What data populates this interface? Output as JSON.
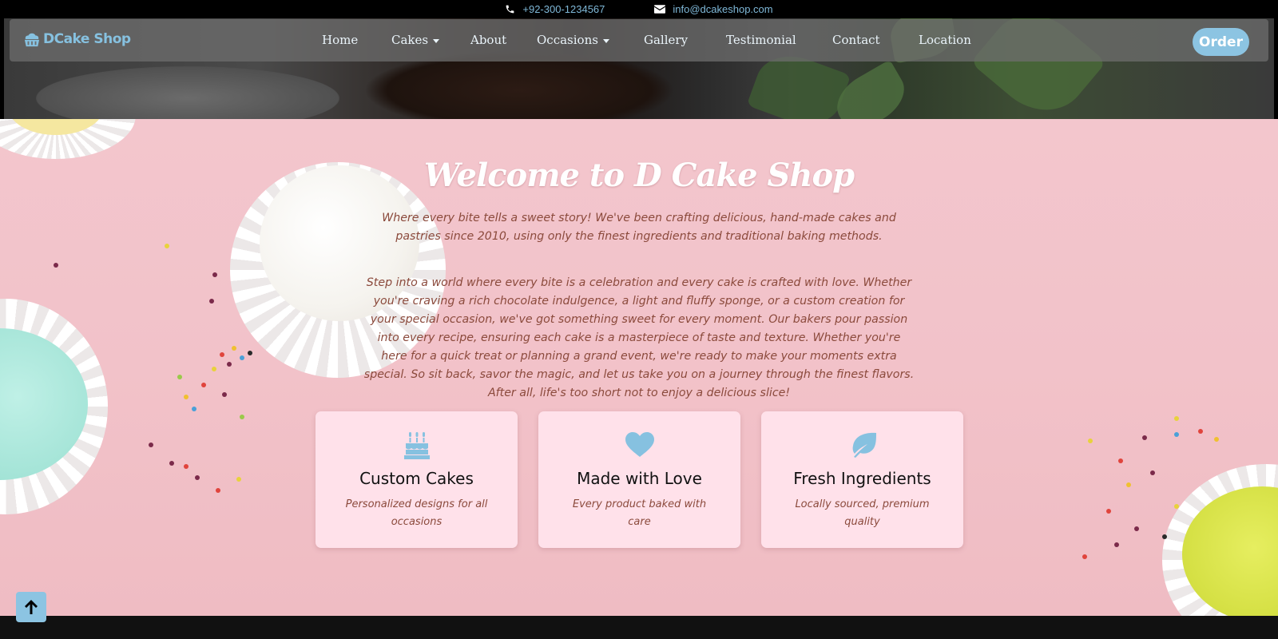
{
  "topbar": {
    "phone": "+92-300-1234567",
    "email": "info@dcakeshop.com",
    "phone_icon": "phone-icon",
    "email_icon": "envelope-icon"
  },
  "navbar": {
    "brand": "DCake Shop",
    "brand_icon": "cake-icon",
    "links": [
      {
        "label": "Home",
        "dropdown": false
      },
      {
        "label": "Cakes",
        "dropdown": true
      },
      {
        "label": "About",
        "dropdown": false
      },
      {
        "label": "Occasions",
        "dropdown": true
      },
      {
        "label": "Gallery",
        "dropdown": false
      },
      {
        "label": "Testimonial",
        "dropdown": false
      },
      {
        "label": "Contact",
        "dropdown": false
      },
      {
        "label": "Location",
        "dropdown": false
      }
    ],
    "order_label": "Order"
  },
  "welcome": {
    "title": "Welcome to D Cake Shop",
    "intro": "Where every bite tells a sweet story! We've been crafting delicious, hand-made cakes and pastries since 2010, using only the finest ingredients and traditional baking methods.",
    "story": "Step into a world where every bite is a celebration and every cake is crafted with love. Whether you're craving a rich chocolate indulgence, a light and fluffy sponge, or a custom creation for your special occasion, we've got something sweet for every moment. Our bakers pour passion into every recipe, ensuring each cake is a masterpiece of taste and texture. Whether you're here for a quick treat or planning a grand event, we're ready to make your moments extra special. So sit back, savor the magic, and let us take you on a journey through the finest flavors. After all, life's too short not to enjoy a delicious slice!"
  },
  "features": [
    {
      "icon": "birthday-cake-icon",
      "title": "Custom Cakes",
      "desc": "Personalized designs for all occasions"
    },
    {
      "icon": "heart-icon",
      "title": "Made with Love",
      "desc": "Every product baked with care"
    },
    {
      "icon": "leaf-icon",
      "title": "Fresh Ingredients",
      "desc": "Locally sourced, premium quality"
    }
  ],
  "back_to_top_icon": "arrow-up-icon",
  "colors": {
    "accent": "#8cc4e2",
    "text_brown": "#8b4a3c",
    "card_bg": "#ffe1ea",
    "section_bg": "#f3c6cd"
  }
}
